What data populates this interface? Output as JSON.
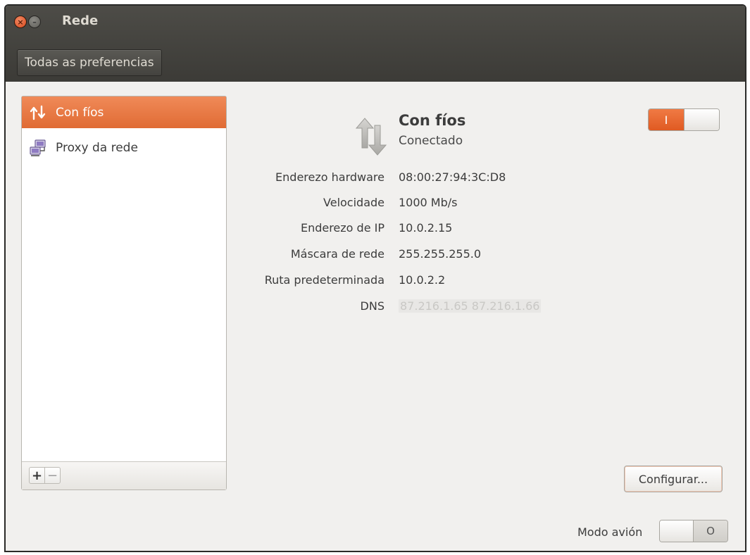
{
  "window": {
    "title": "Rede",
    "all_preferences_label": "Todas as preferencias"
  },
  "sidebar": {
    "items": [
      {
        "label": "Con fíos",
        "icon": "wired-network-icon",
        "selected": true
      },
      {
        "label": "Proxy da rede",
        "icon": "network-proxy-icon",
        "selected": false
      }
    ],
    "add_label": "+",
    "remove_label": "−"
  },
  "connection": {
    "name": "Con fíos",
    "status": "Conectado",
    "switch_state_label": "I",
    "switch_on": true
  },
  "details": [
    {
      "label": "Enderezo hardware",
      "value": "08:00:27:94:3C:D8"
    },
    {
      "label": "Velocidade",
      "value": "1000 Mb/s"
    },
    {
      "label": "Enderezo de IP",
      "value": "10.0.2.15"
    },
    {
      "label": "Máscara de rede",
      "value": "255.255.255.0"
    },
    {
      "label": "Ruta predeterminada",
      "value": "10.0.2.2"
    },
    {
      "label": "DNS",
      "value": "87.216.1.65 87.216.1.66"
    }
  ],
  "buttons": {
    "configure_label": "Configurar..."
  },
  "airplane_mode": {
    "label": "Modo avión",
    "switch_state_label": "O",
    "on": false
  },
  "colors": {
    "accent": "#e8672c",
    "titlebar": "#3c3b37"
  }
}
